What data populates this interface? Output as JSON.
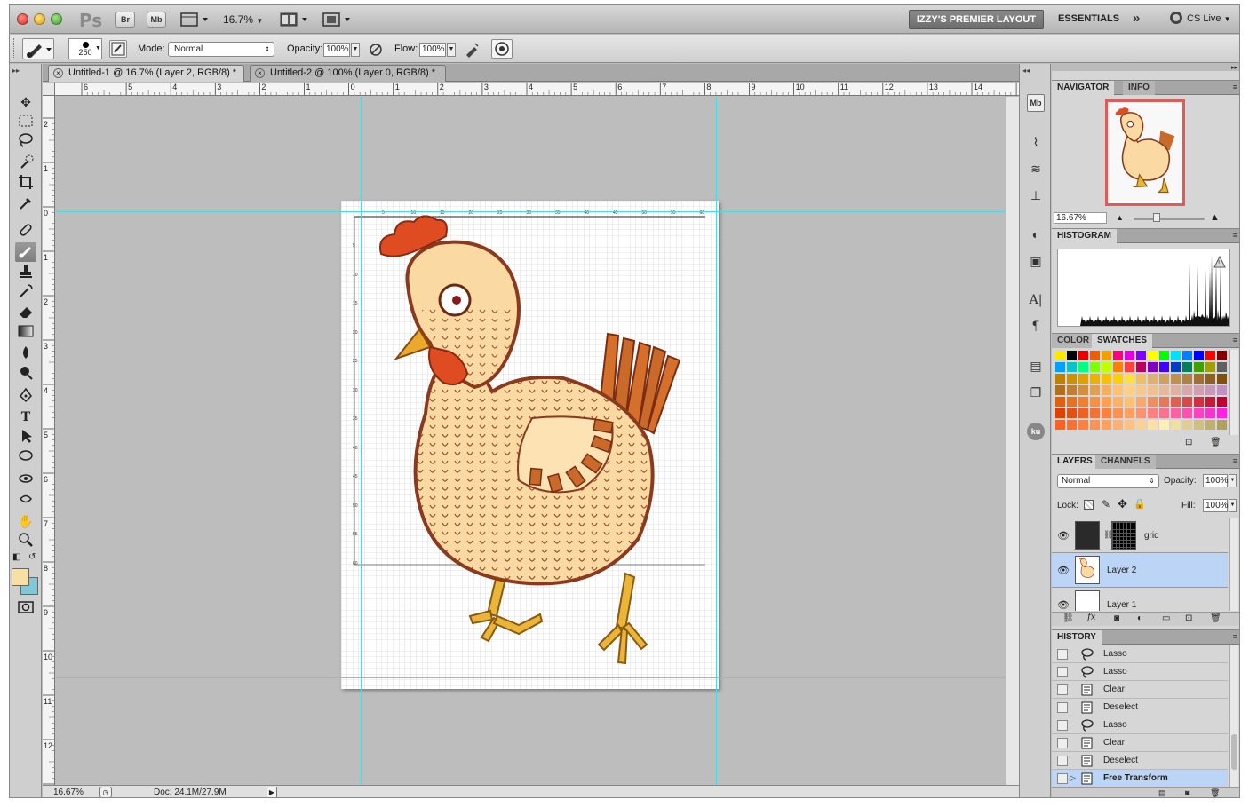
{
  "app": {
    "logo": "Ps",
    "bridge_label": "Br",
    "minibridge_label": "Mb",
    "zoom_level": "16.7%",
    "workspace_active": "IZZY'S PREMIER LAYOUT",
    "workspace_essentials": "ESSENTIALS",
    "cs_live": "CS Live"
  },
  "options": {
    "brush_size": "250",
    "mode_label": "Mode:",
    "mode_value": "Normal",
    "opacity_label": "Opacity:",
    "opacity_value": "100%",
    "flow_label": "Flow:",
    "flow_value": "100%"
  },
  "tabs": [
    {
      "label": "Untitled-1 @ 16.7% (Layer 2, RGB/8) *"
    },
    {
      "label": "Untitled-2 @ 100% (Layer 0, RGB/8) *"
    }
  ],
  "rulers": {
    "top": [
      "6",
      "5",
      "4",
      "3",
      "2",
      "1",
      "0",
      "1",
      "2",
      "3",
      "4",
      "5",
      "6",
      "7",
      "8",
      "9",
      "10",
      "11",
      "12",
      "13",
      "14"
    ],
    "left": [
      "2",
      "1",
      "0",
      "1",
      "2",
      "3",
      "4",
      "5",
      "6",
      "7",
      "8",
      "9",
      "10",
      "11",
      "12"
    ]
  },
  "grid_scale": {
    "top": [
      "5",
      "10",
      "15",
      "20",
      "25",
      "30",
      "35",
      "40",
      "45",
      "50",
      "55",
      "60"
    ],
    "left": [
      "5",
      "10",
      "15",
      "20",
      "25",
      "30",
      "35",
      "40",
      "45",
      "50",
      "55",
      "60"
    ]
  },
  "status": {
    "zoom": "16.67%",
    "doc_size": "Doc: 24.1M/27.9M"
  },
  "colors": {
    "foreground": "#f9dfa4",
    "background": "#7fc8d9",
    "guide": "#4fd8e0",
    "selection": "#bcd4f5"
  },
  "navigator": {
    "tab_navigator": "NAVIGATOR",
    "tab_info": "INFO",
    "zoom": "16.67%"
  },
  "histogram": {
    "tab": "HISTOGRAM"
  },
  "color_panel": {
    "tab_color": "COLOR",
    "tab_swatches": "SWATCHES"
  },
  "layers_panel": {
    "tab_layers": "LAYERS",
    "tab_channels": "CHANNELS",
    "blend_mode": "Normal",
    "opacity_label": "Opacity:",
    "opacity_value": "100%",
    "lock_label": "Lock:",
    "fill_label": "Fill:",
    "fill_value": "100%",
    "layers": [
      {
        "name": "grid",
        "selected": false
      },
      {
        "name": "Layer 2",
        "selected": true
      },
      {
        "name": "Layer 1",
        "selected": false
      }
    ]
  },
  "history_panel": {
    "tab": "HISTORY",
    "items": [
      {
        "label": "Lasso",
        "icon": "lasso-icon"
      },
      {
        "label": "Lasso",
        "icon": "lasso-icon"
      },
      {
        "label": "Clear",
        "icon": "history-doc-icon"
      },
      {
        "label": "Deselect",
        "icon": "history-doc-icon"
      },
      {
        "label": "Lasso",
        "icon": "lasso-icon"
      },
      {
        "label": "Clear",
        "icon": "history-doc-icon"
      },
      {
        "label": "Deselect",
        "icon": "history-doc-icon"
      },
      {
        "label": "Free Transform",
        "icon": "history-doc-icon"
      }
    ]
  }
}
